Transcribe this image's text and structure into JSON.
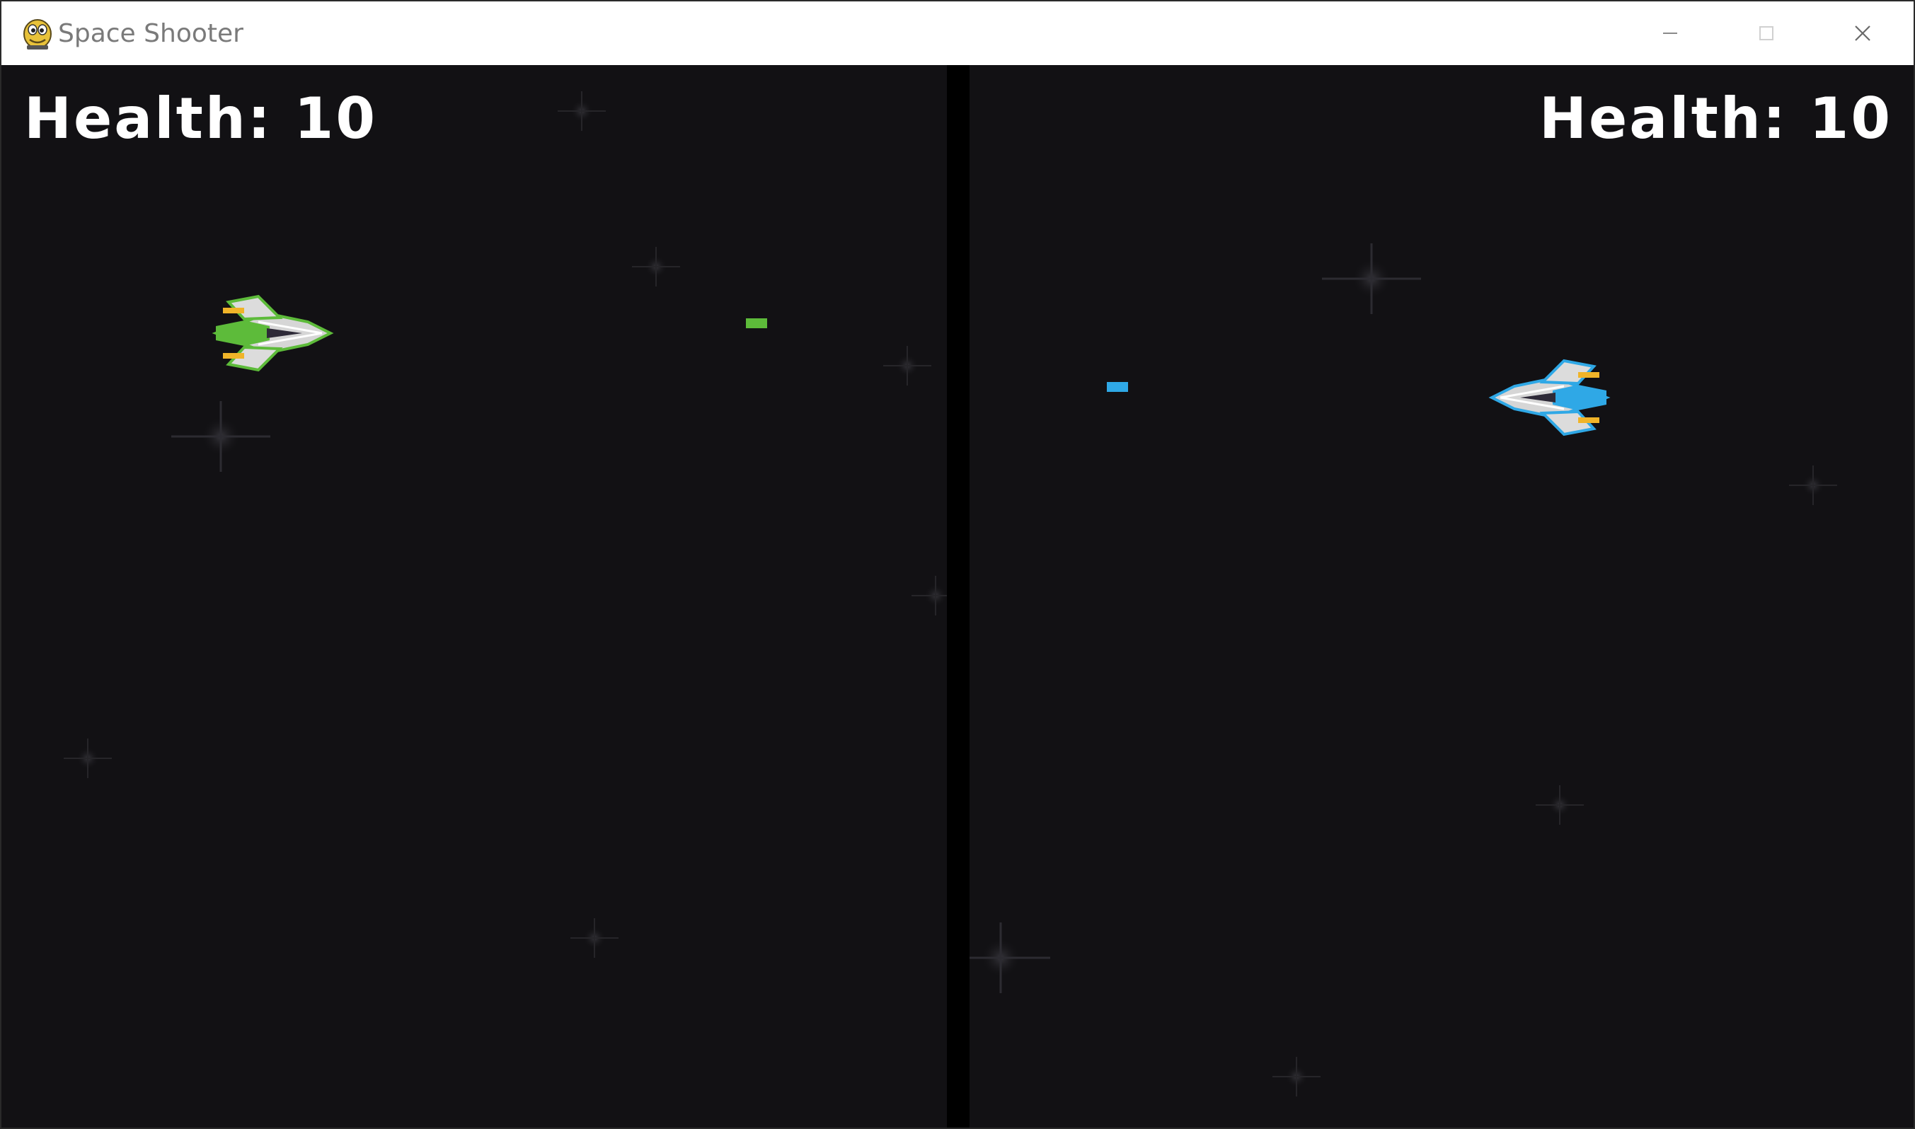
{
  "window": {
    "title": "Space Shooter",
    "icon": "pygame-snake-icon",
    "controls": [
      "minimize-icon",
      "maximize-icon",
      "close-icon"
    ]
  },
  "game": {
    "background_color": "#121114",
    "divider_color": "#000000",
    "left_player": {
      "health_label": "Health: 10",
      "ship_color": "#5dbb3a",
      "bullet_color": "#5dbb3a"
    },
    "right_player": {
      "health_label": "Health: 10",
      "ship_color": "#2fa8e6",
      "bullet_color": "#2fa8e6"
    }
  }
}
